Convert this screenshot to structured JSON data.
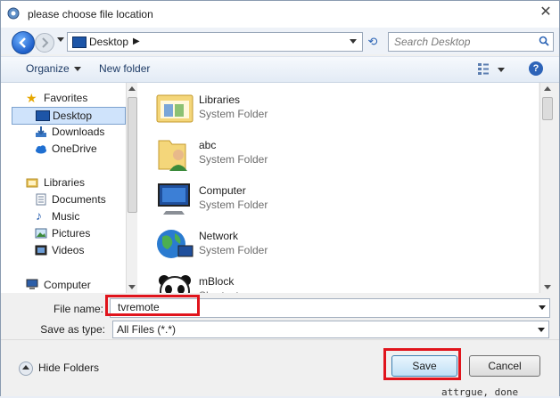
{
  "window": {
    "title": "please choose file location"
  },
  "nav": {
    "address": "Desktop",
    "address_sep": "▶",
    "search_placeholder": "Search Desktop"
  },
  "toolbar": {
    "organize_label": "Organize",
    "new_folder_label": "New folder",
    "help_label": "?"
  },
  "sidebar": {
    "items": [
      {
        "label": "Favorites",
        "icon": "star-icon"
      },
      {
        "label": "Desktop",
        "icon": "desktop-icon",
        "selected": true
      },
      {
        "label": "Downloads",
        "icon": "downloads-icon"
      },
      {
        "label": "OneDrive",
        "icon": "onedrive-icon"
      },
      {
        "label": "Libraries",
        "icon": "libraries-icon"
      },
      {
        "label": "Documents",
        "icon": "documents-icon"
      },
      {
        "label": "Music",
        "icon": "music-icon"
      },
      {
        "label": "Pictures",
        "icon": "pictures-icon"
      },
      {
        "label": "Videos",
        "icon": "videos-icon"
      },
      {
        "label": "Computer",
        "icon": "computer-icon"
      }
    ]
  },
  "files": [
    {
      "name": "Libraries",
      "type": "System Folder",
      "icon": "libraries-folder-icon"
    },
    {
      "name": "abc",
      "type": "System Folder",
      "icon": "user-folder-icon"
    },
    {
      "name": "Computer",
      "type": "System Folder",
      "icon": "computer-icon"
    },
    {
      "name": "Network",
      "type": "System Folder",
      "icon": "network-globe-icon"
    },
    {
      "name": "mBlock",
      "type": "Shortcut",
      "icon": "panda-shortcut-icon"
    }
  ],
  "form": {
    "file_name_label": "File name:",
    "file_name_value": "tvremote",
    "save_as_type_label": "Save as type:",
    "save_as_type_value": "All Files (*.*)"
  },
  "footer": {
    "hide_folders_label": "Hide Folders",
    "save_label": "Save",
    "cancel_label": "Cancel"
  },
  "background_text": "attrgue, done",
  "colors": {
    "highlight": "#e0141c",
    "accent": "#1d55a7"
  }
}
